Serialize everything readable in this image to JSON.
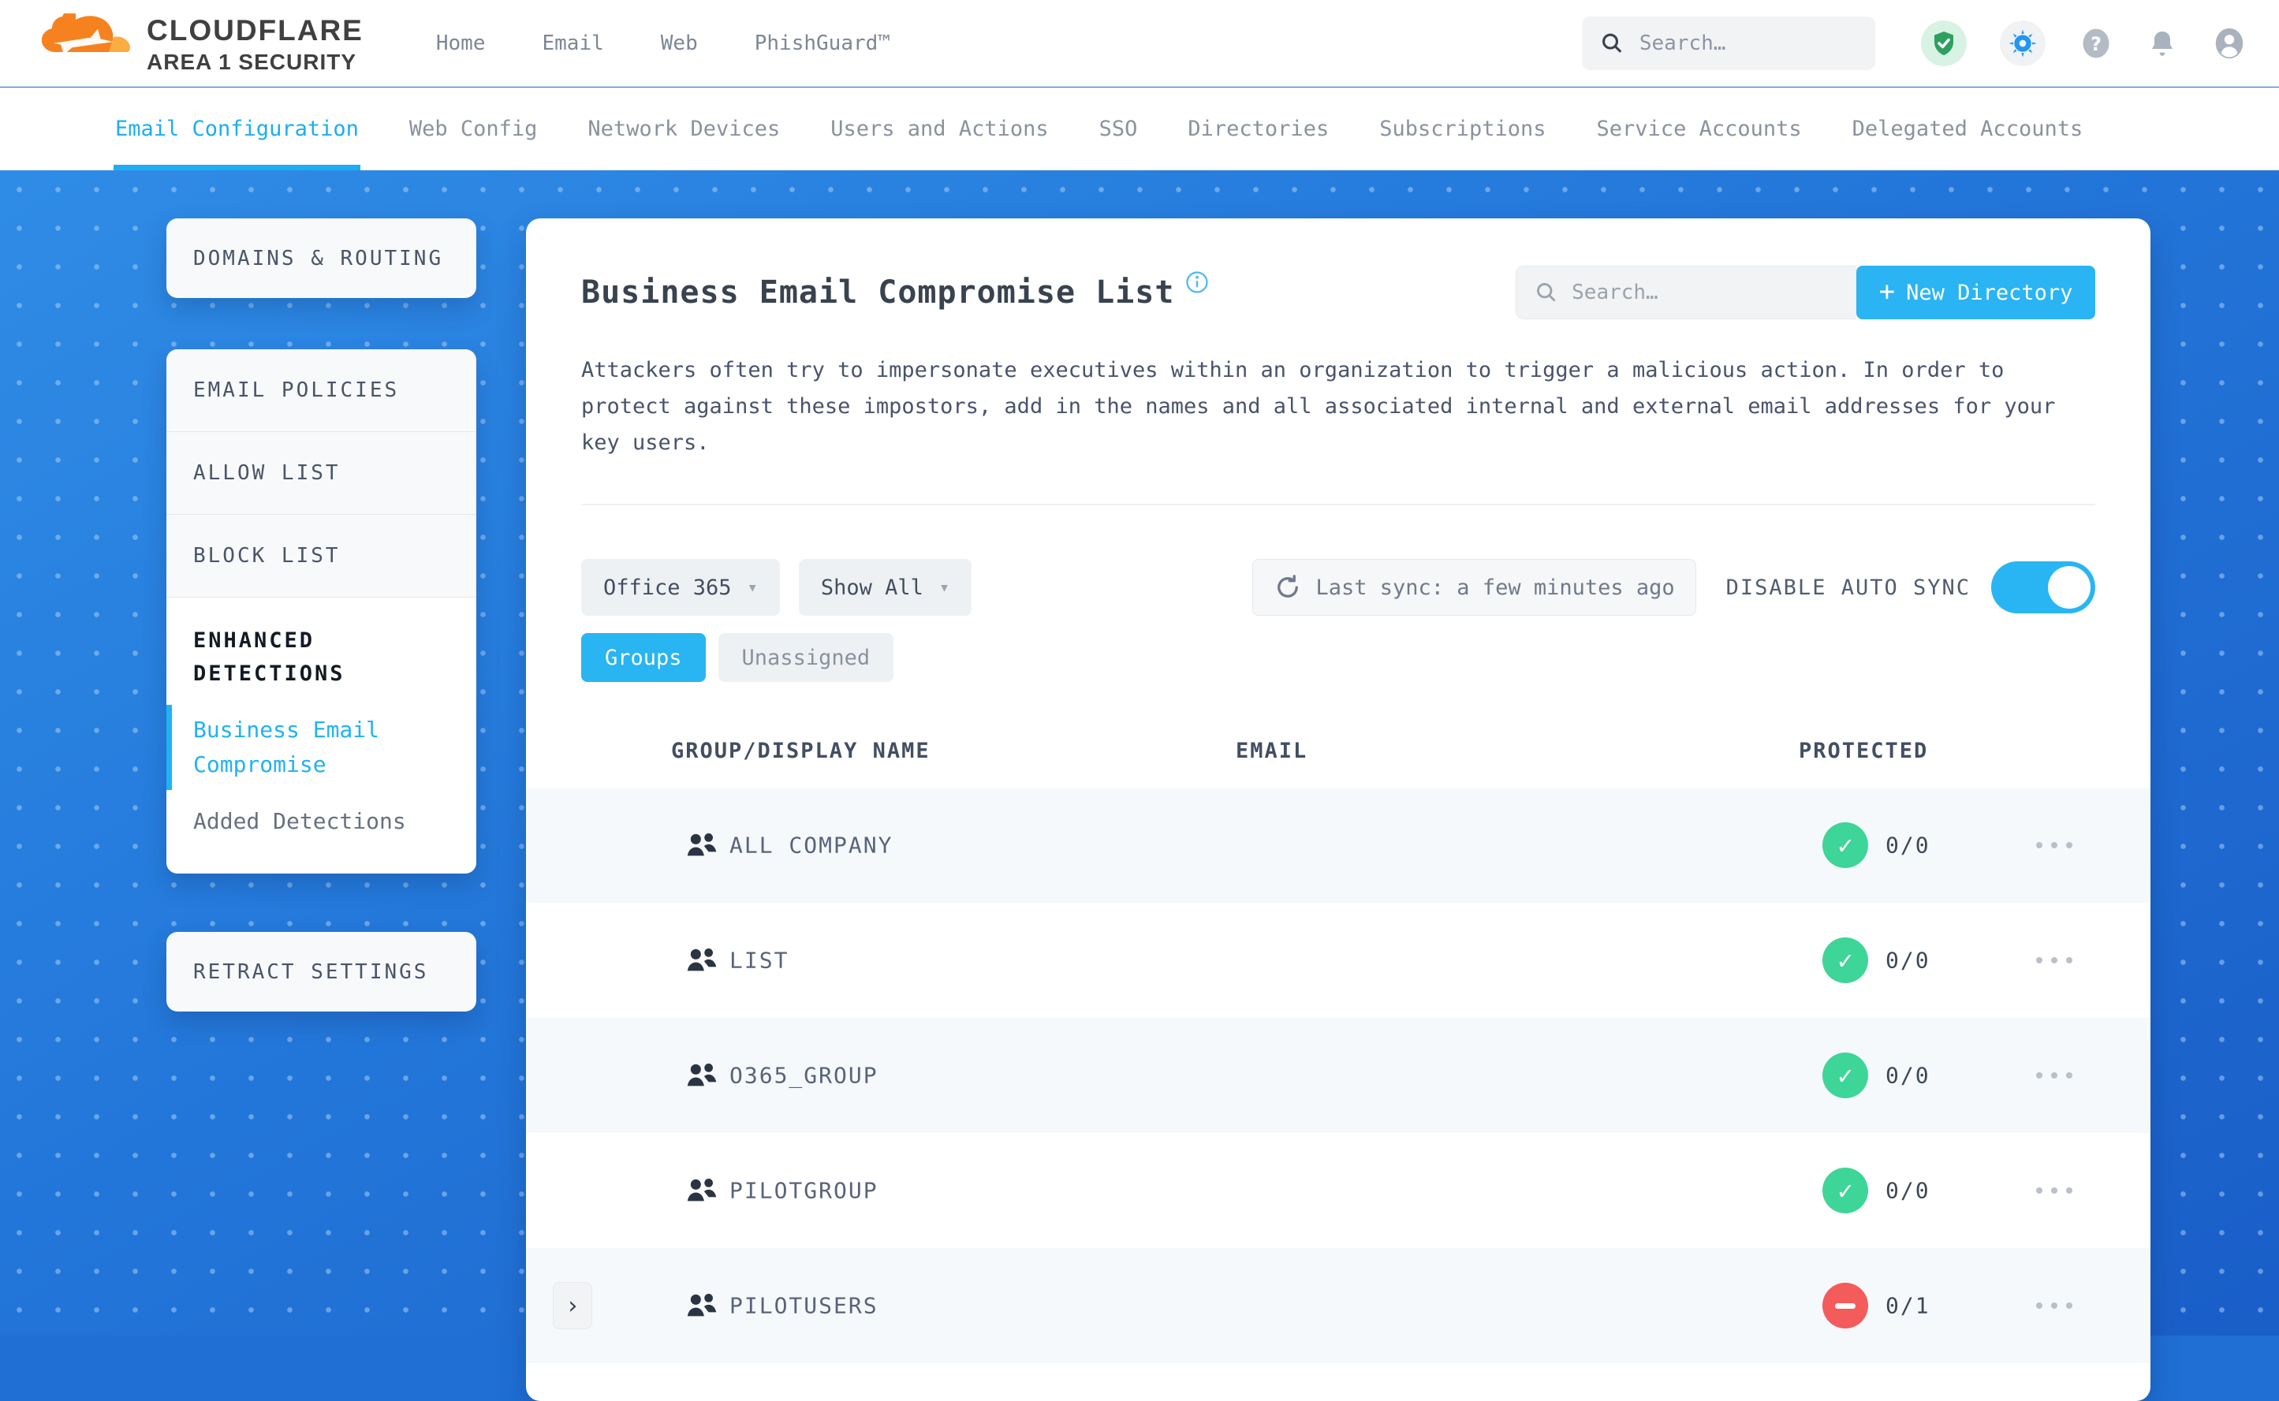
{
  "header": {
    "logo": {
      "brand": "CLOUDFLARE",
      "sub": "AREA 1 SECURITY"
    },
    "nav": [
      "Home",
      "Email",
      "Web",
      "PhishGuard™"
    ],
    "search_placeholder": "Search…",
    "icons": [
      "shield-check-icon",
      "gear-icon",
      "help-icon",
      "bell-icon",
      "profile-icon"
    ]
  },
  "subnav": {
    "items": [
      {
        "label": "Email Configuration",
        "active": true
      },
      {
        "label": "Web Config"
      },
      {
        "label": "Network Devices"
      },
      {
        "label": "Users and Actions"
      },
      {
        "label": "SSO"
      },
      {
        "label": "Directories"
      },
      {
        "label": "Subscriptions"
      },
      {
        "label": "Service Accounts"
      },
      {
        "label": "Delegated Accounts"
      }
    ]
  },
  "sidebar": {
    "domains_routing": "DOMAINS & ROUTING",
    "email_policies": "EMAIL POLICIES",
    "allow_list": "ALLOW LIST",
    "block_list": "BLOCK LIST",
    "enhanced_detections": "ENHANCED DETECTIONS",
    "business_email_compromise": "Business Email Compromise",
    "added_detections": "Added Detections",
    "retract_settings": "RETRACT SETTINGS"
  },
  "main": {
    "title": "Business Email Compromise List",
    "search_placeholder": "Search…",
    "new_directory_label": "New Directory",
    "description": "Attackers often try to impersonate executives within an organization to trigger a malicious action. In order to protect against these impostors, add in the names and all associated internal and external email addresses for your key users.",
    "controls": {
      "directory_filter": "Office 365",
      "show_filter": "Show All",
      "last_sync": "Last sync: a few minutes ago",
      "auto_sync_label": "DISABLE AUTO SYNC",
      "auto_sync_on": true
    },
    "tabs": [
      {
        "label": "Groups",
        "active": true
      },
      {
        "label": "Unassigned",
        "active": false
      }
    ],
    "table": {
      "columns": [
        "GROUP/DISPLAY NAME",
        "EMAIL",
        "PROTECTED"
      ],
      "rows": [
        {
          "name": "ALL COMPANY",
          "email": "",
          "protected": "0/0",
          "status": "ok",
          "expandable": false
        },
        {
          "name": "LIST",
          "email": "",
          "protected": "0/0",
          "status": "ok",
          "expandable": false
        },
        {
          "name": "O365_GROUP",
          "email": "",
          "protected": "0/0",
          "status": "ok",
          "expandable": false
        },
        {
          "name": "PILOTGROUP",
          "email": "",
          "protected": "0/0",
          "status": "ok",
          "expandable": false
        },
        {
          "name": "PILOTUSERS",
          "email": "",
          "protected": "0/1",
          "status": "blocked",
          "expandable": true
        }
      ]
    }
  },
  "colors": {
    "accent_cyan": "#29b5f3",
    "background_blue": "#2376d9",
    "success_green": "#3ed598",
    "danger_red": "#f45b5b",
    "gear_blue": "#2196f3",
    "shield_green": "#2da05f"
  }
}
